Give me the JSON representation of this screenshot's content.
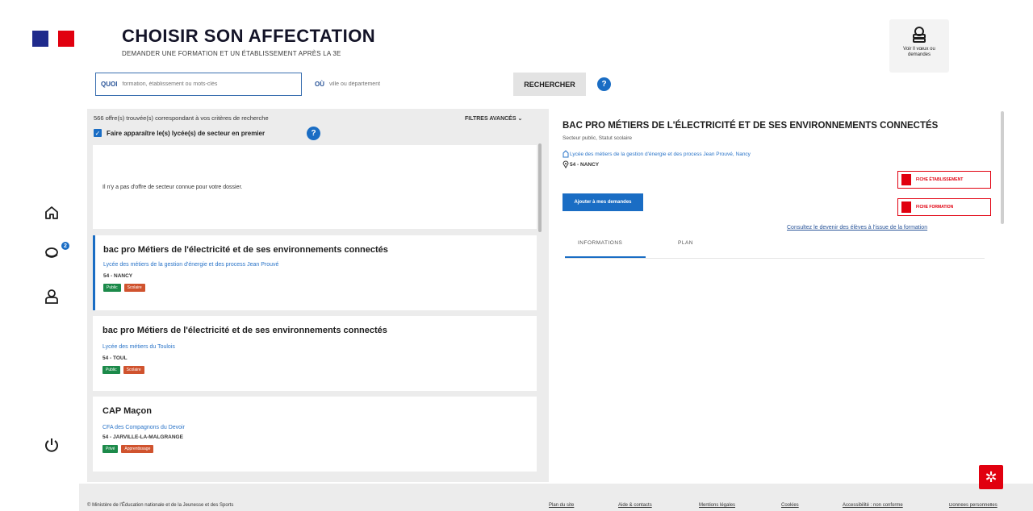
{
  "header": {
    "title": "CHOISIR SON AFFECTATION",
    "subtitle": "DEMANDER UNE FORMATION ET UN ÉTABLISSEMENT APRÈS LA 3E",
    "voeux_label": "Voir ll vœux ou demandes"
  },
  "search": {
    "quoi_label": "QUOI",
    "quoi_placeholder": "formation, établissement ou mots-clés",
    "ou_label": "OÙ",
    "ou_placeholder": "ville ou département",
    "button": "RECHERCHER",
    "help": "?"
  },
  "results": {
    "count_text": "566 offre(s) trouvée(s) correspondant à vos critères de recherche",
    "filters_label": "FILTRES AVANCÉS",
    "checkbox_label": "Faire apparaître le(s) lycée(s) de secteur en premier",
    "empty_sector_text": "Il n'y a pas d'offre de secteur connue pour votre dossier.",
    "cards": [
      {
        "title": "bac pro Métiers de l'électricité et de ses environnements connectés",
        "school": "Lycée des métiers de la gestion d'énergie et des process Jean Prouvé",
        "location": "54 - NANCY",
        "tag1": "Public",
        "tag2": "Scolaire"
      },
      {
        "title": "bac pro Métiers de l'électricité et de ses environnements connectés",
        "school": "Lycée des métiers du Toulois",
        "location": "54 - TOUL",
        "tag1": "Public",
        "tag2": "Scolaire"
      },
      {
        "title": "CAP Maçon",
        "school": "CFA des Compagnons du Devoir",
        "location": "54 - JARVILLE-LA-MALGRANGE",
        "tag1": "Privé",
        "tag2": "Apprentissage"
      }
    ]
  },
  "detail": {
    "title": "BAC PRO MÉTIERS DE L'ÉLECTRICITÉ ET DE SES ENVIRONNEMENTS CONNECTÉS",
    "subtitle": "Secteur public, Statut scolaire",
    "school": "Lycée des métiers de la gestion d'énergie et des process Jean Prouvé, Nancy",
    "location": "54 - NANCY",
    "add_button": "Ajouter à mes demandes",
    "fiche_etab": "FICHE ÉTABLISSEMENT",
    "fiche_formation": "FICHE FORMATION",
    "consult_link": "Consultez le devenir des élèves à l'issue de la formation",
    "tab_info": "INFORMATIONS",
    "tab_plan": "PLAN"
  },
  "nav": {
    "badge": "2"
  },
  "footer": {
    "copyright": "© Ministère de l'Éducation nationale et de la Jeunesse et des Sports",
    "links": [
      "Plan du site",
      "Aide & contacts",
      "Mentions légales",
      "Cookies",
      "Accessibilité : non conforme",
      "Données personnelles"
    ]
  },
  "colors": {
    "accent": "#1a6dc4",
    "marianne_red": "#e1000f",
    "marianne_blue": "#1f2a8c"
  }
}
